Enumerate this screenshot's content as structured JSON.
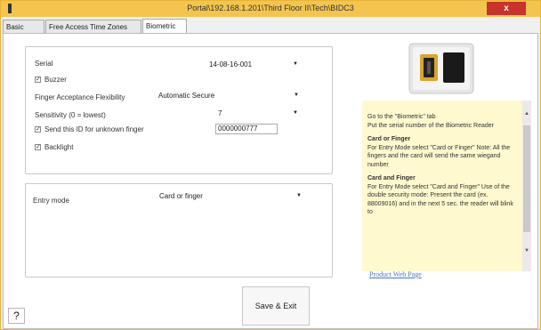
{
  "window": {
    "title": "Portal\\192.168.1.201\\Third Floor II\\Tech\\BIDC3",
    "close_glyph": "x"
  },
  "tabs": [
    {
      "label": "Basic",
      "active": false
    },
    {
      "label": "Free Access Time Zones",
      "active": false
    },
    {
      "label": "Biometric",
      "active": true
    }
  ],
  "settings": {
    "serial_label": "Serial",
    "serial_value": "14-08-16-001",
    "buzzer_label": "Buzzer",
    "buzzer_checked": true,
    "finger_flex_label": "Finger Acceptance Flexibility",
    "finger_flex_value": "Automatic Secure",
    "sensitivity_label": "Sensitivity (0 = lowest)",
    "sensitivity_value": "7",
    "send_id_label": "Send this ID for unknown finger",
    "send_id_checked": true,
    "send_id_value": "0000000777",
    "backlight_label": "Backlight",
    "backlight_checked": true
  },
  "entry": {
    "label": "Entry mode",
    "value": "Card or finger"
  },
  "help": {
    "line1": "Go to the \"Biometric\" tab",
    "line2": "Put the serial number of the Biometric Reader",
    "card_or_finger_head": "Card or Finger",
    "card_or_finger_text": "For Entry Mode select \"Card or Finger\" Note: All the fingers and the card will send the same wiegand number",
    "card_and_finger_head": "Card and Finger",
    "card_and_finger_text": "For Entry Mode select \"Card and Finger\" Use of the double security mode: Present the card (ex. 88009016) and in the next 5 sec. the reader will blink to"
  },
  "link": {
    "label": "Product Web Page"
  },
  "buttons": {
    "save_exit": "Save & Exit",
    "help": "?"
  },
  "icons": {
    "dropdown": "chevron-down-icon",
    "check": "check-icon"
  },
  "colors": {
    "titlebar": "#f3c54e",
    "close": "#c8332b",
    "help_panel": "#fff9cf",
    "link": "#4a78c0"
  }
}
